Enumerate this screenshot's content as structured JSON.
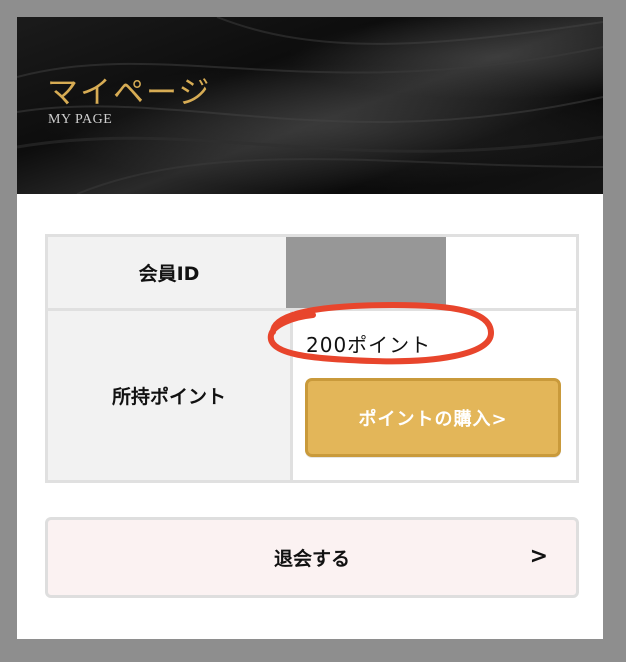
{
  "header": {
    "title": "マイページ",
    "subtitle": "MY PAGE"
  },
  "member": {
    "id_label": "会員ID",
    "id_value_redacted": true
  },
  "points": {
    "label": "所持ポイント",
    "value": "200ポイント",
    "buy_button_label": "ポイントの購入>"
  },
  "withdraw": {
    "label": "退会する",
    "chevron": ">"
  },
  "colors": {
    "gold": "#d7ac54",
    "button_gold": "#e3b659",
    "highlight_red": "#e8452c",
    "withdraw_bg": "#fbf2f2"
  }
}
